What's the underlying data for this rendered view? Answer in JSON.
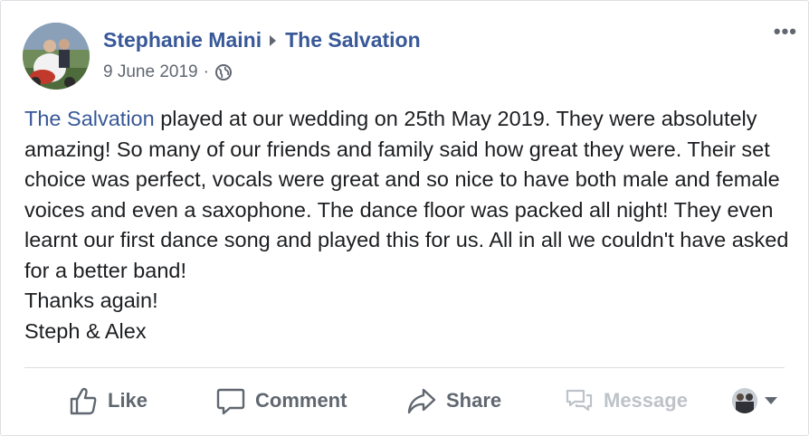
{
  "post": {
    "author": "Stephanie Maini",
    "target_page": "The Salvation",
    "date": "9 June 2019",
    "separator": "·",
    "privacy_icon": "globe-icon",
    "more_label": "•••",
    "body": {
      "mention": "The Salvation",
      "text_after_mention": " played at our wedding on 25th May 2019. They were absolutely amazing! So many of our friends and family said how great they were. Their set choice was perfect, vocals were great and so nice to have both male and female voices and even a saxophone. The dance floor was packed all night! They even learnt our first dance song and played this for us. All in all we couldn't have asked for a better band!",
      "line_thanks": "Thanks again!",
      "line_signoff": "Steph & Alex"
    }
  },
  "actions": {
    "like": "Like",
    "comment": "Comment",
    "share": "Share",
    "message": "Message"
  },
  "colors": {
    "link": "#385898",
    "muted": "#606770",
    "disabled": "#bec3c9",
    "text": "#1c1e21",
    "divider": "#dadde1"
  }
}
